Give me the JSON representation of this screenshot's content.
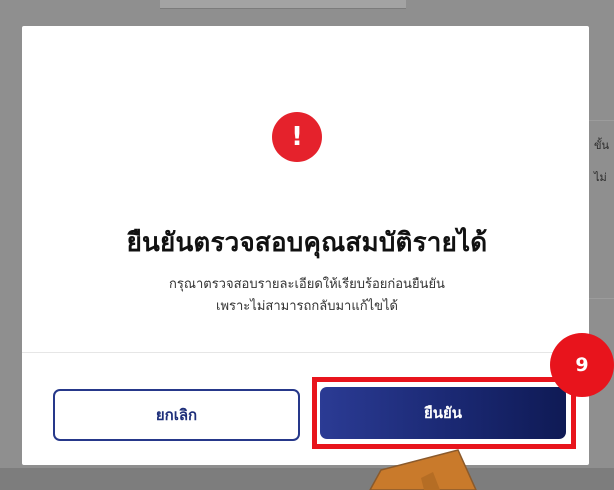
{
  "background": {
    "right_text_lines": [
      "ขั้น",
      "ไม่"
    ]
  },
  "modal": {
    "icon": "exclamation-icon",
    "icon_glyph": "!",
    "title": "ยืนยันตรวจสอบคุณสมบัติรายได้",
    "description_line1": "กรุณาตรวจสอบรายละเอียดให้เรียบร้อยก่อนยืนยัน",
    "description_line2": "เพราะไม่สามารถกลับมาแก้ไขได้",
    "cancel_label": "ยกเลิก",
    "confirm_label": "ยืนยัน"
  },
  "annotation": {
    "step_number": "9",
    "highlight_color": "#e8141c",
    "arrow_color": "#c97a2b"
  },
  "colors": {
    "primary": "#1e2f7a",
    "alert": "#e5222c"
  }
}
